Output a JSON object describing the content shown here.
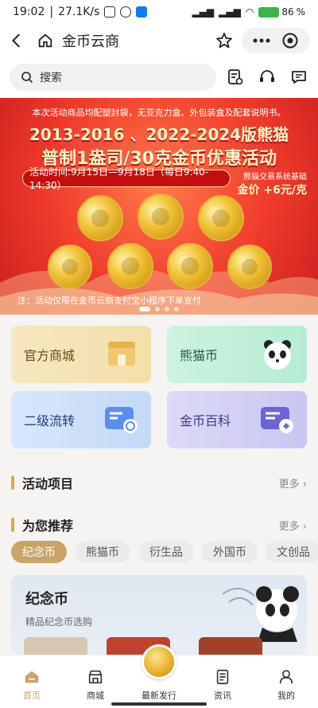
{
  "status": {
    "time": "19:02",
    "speed": "27.1K/s",
    "battery": "86"
  },
  "titlebar": {
    "title": "金币云商"
  },
  "search": {
    "placeholder": "搜索"
  },
  "banner": {
    "notice": "本次活动商品均配塑封袋，无亚克力盒、外包装盒及配套说明书。",
    "headline1": "2013-2016 、2022-2024版熊猫",
    "headline2": "普制1盎司/30克金币优惠活动",
    "time": "活动时间:9月15日—9月18日（每日9:40-14:30）",
    "tag_line": "熊猫交易系统基础",
    "tag_price": "金价 +6元/克",
    "footnote": "注：活动仅限在金币云商支付宝小程序下单支付"
  },
  "grid": [
    {
      "label": "官方商城"
    },
    {
      "label": "熊猫币"
    },
    {
      "label": "二级流转"
    },
    {
      "label": "金币百科"
    }
  ],
  "sections": {
    "activity": {
      "title": "活动项目",
      "more": "更多"
    },
    "recommend": {
      "title": "为您推荐",
      "more": "更多"
    }
  },
  "chips": [
    "纪念币",
    "熊猫币",
    "衍生品",
    "外国币",
    "文创品"
  ],
  "rec_card": {
    "title": "纪念币",
    "subtitle": "精品纪念币选购"
  },
  "tabbar": [
    "首页",
    "商城",
    "最新发行",
    "资讯",
    "我的"
  ],
  "colors": {
    "accent": "#c9a46a",
    "banner": "#ef3a2b"
  }
}
